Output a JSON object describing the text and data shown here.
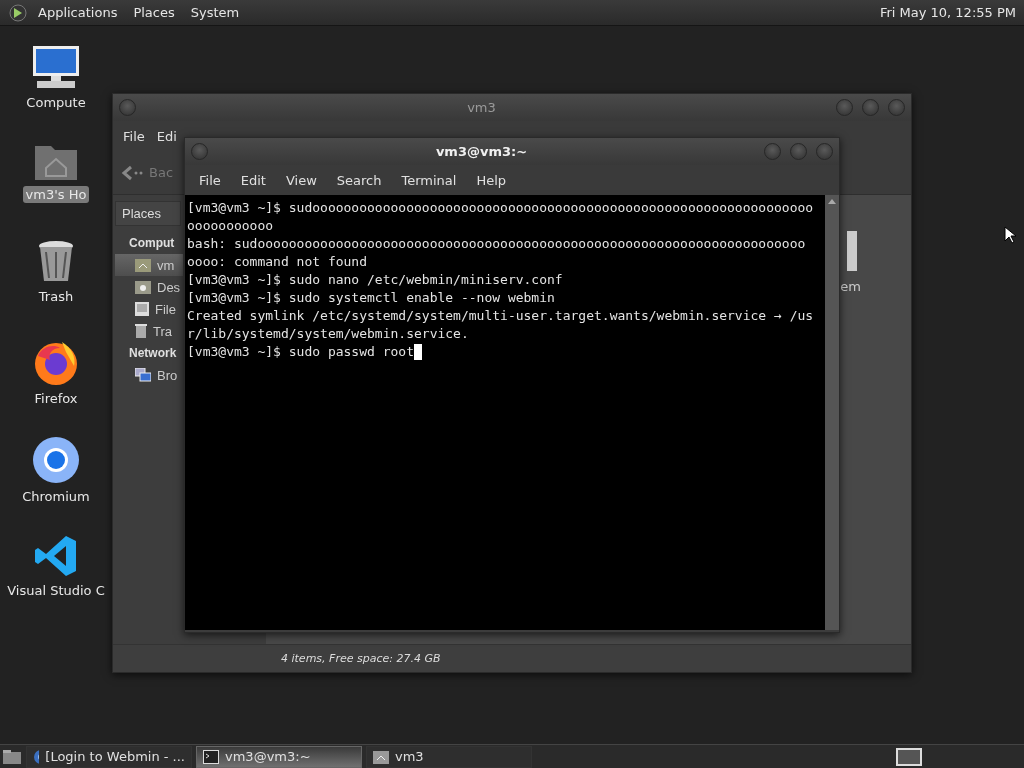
{
  "top_panel": {
    "menus": [
      "Applications",
      "Places",
      "System"
    ],
    "clock": "Fri May 10, 12:55 PM"
  },
  "desktop_icons": [
    {
      "kind": "computer",
      "label": "Compute",
      "selected": false
    },
    {
      "kind": "home",
      "label": "vm3's Ho",
      "selected": true
    },
    {
      "kind": "trash",
      "label": "Trash",
      "selected": false
    },
    {
      "kind": "firefox",
      "label": "Firefox",
      "selected": false
    },
    {
      "kind": "chromium",
      "label": "Chromium",
      "selected": false
    },
    {
      "kind": "vscode",
      "label": "Visual Studio C",
      "selected": false
    }
  ],
  "file_manager": {
    "title": "vm3",
    "menu": [
      "File",
      "Edi"
    ],
    "back_label": "Bac",
    "sidebar_tab": "Places",
    "sidebar": [
      {
        "kind": "heading",
        "label": "Comput"
      },
      {
        "kind": "home",
        "label": "vm",
        "selected": true
      },
      {
        "kind": "desktop",
        "label": "Des",
        "selected": false
      },
      {
        "kind": "filesystem",
        "label": "File",
        "selected": false
      },
      {
        "kind": "trash",
        "label": "Tra",
        "selected": false
      },
      {
        "kind": "heading",
        "label": "Network"
      },
      {
        "kind": "network",
        "label": "Bro",
        "selected": false
      }
    ],
    "content_label": "em",
    "status": "4 items, Free space: 27.4 GB"
  },
  "terminal": {
    "title": "vm3@vm3:~",
    "menu": [
      "File",
      "Edit",
      "View",
      "Search",
      "Terminal",
      "Help"
    ],
    "lines": [
      "[vm3@vm3 ~]$ sudoooooooooooooooooooooooooooooooooooooooooooooooooooooooooooooooo",
      "ooooooooooo",
      "bash: sudoooooooooooooooooooooooooooooooooooooooooooooooooooooooooooooooooooooo",
      "oooo: command not found",
      "[vm3@vm3 ~]$ sudo nano /etc/webmin/miniserv.conf",
      "[vm3@vm3 ~]$ sudo systemctl enable --now webmin",
      "Created symlink /etc/systemd/system/multi-user.target.wants/webmin.service → /us",
      "r/lib/systemd/system/webmin.service.",
      "[vm3@vm3 ~]$ sudo passwd root"
    ],
    "cursor": true
  },
  "taskbar": {
    "tasks": [
      {
        "kind": "browser",
        "label": "[Login to Webmin - ...",
        "selected": false
      },
      {
        "kind": "terminal",
        "label": "vm3@vm3:~",
        "selected": true
      },
      {
        "kind": "folder",
        "label": "vm3",
        "selected": false
      }
    ]
  }
}
